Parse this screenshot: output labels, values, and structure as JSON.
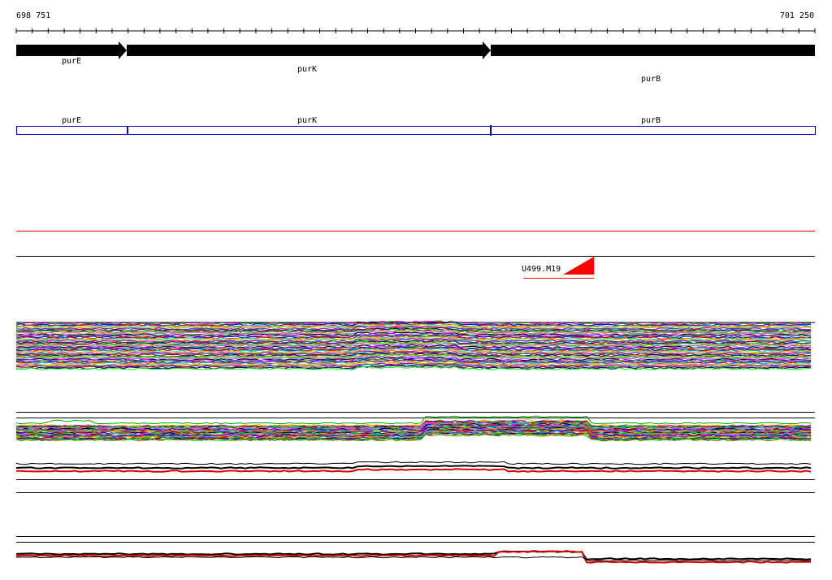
{
  "ruler": {
    "start_coord": "698 751",
    "end_coord": "701 250"
  },
  "genes": [
    {
      "name": "purE"
    },
    {
      "name": "purK"
    },
    {
      "name": "purB"
    }
  ],
  "feature_track": [
    {
      "name": "purE"
    },
    {
      "name": "purK"
    },
    {
      "name": "purB"
    }
  ],
  "marker": {
    "label": "U499.M19"
  },
  "colors": {
    "gene_arrow": "#000000",
    "feature_box": "#0000cc",
    "marker": "#ff0000",
    "separator_red": "#dd0000",
    "separator_black": "#000000",
    "trace_palette": [
      "#ff00ff",
      "#00aa00",
      "#0000ff",
      "#ff0000",
      "#00cccc",
      "#cccc00",
      "#ff8800",
      "#8800ff",
      "#008888",
      "#aa0000",
      "#000088",
      "#00ff00",
      "#888800",
      "#ff66aa",
      "#6688ff",
      "#000000"
    ]
  }
}
